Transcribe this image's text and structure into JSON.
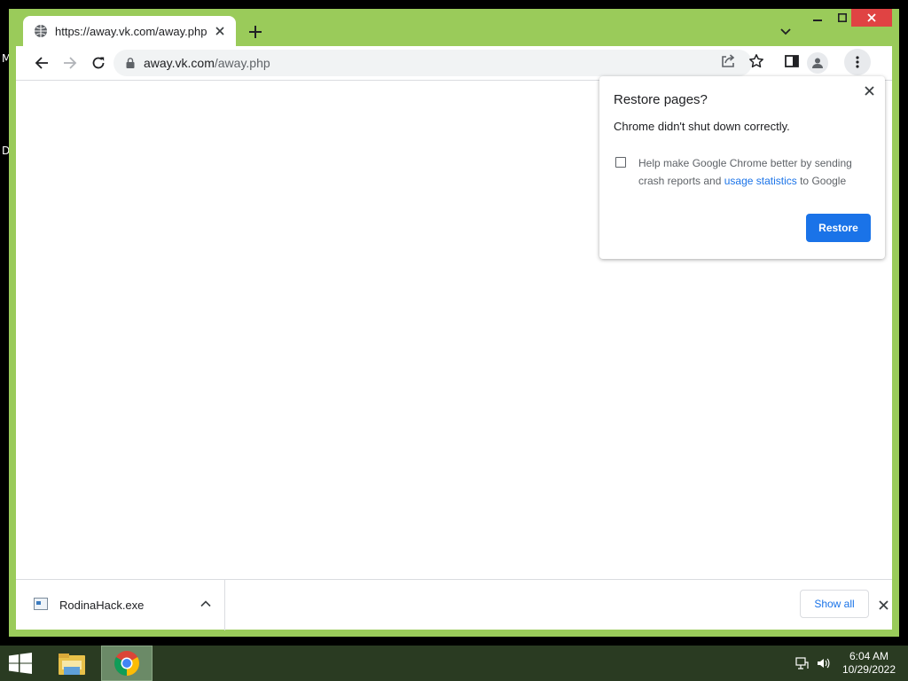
{
  "desktop": {
    "letters": [
      "M",
      "D"
    ]
  },
  "tab": {
    "title": "https://away.vk.com/away.php"
  },
  "omnibox": {
    "host": "away.vk.com",
    "path": "/away.php"
  },
  "popup": {
    "title": "Restore pages?",
    "message": "Chrome didn't shut down correctly.",
    "help_prefix": "Help make Google Chrome better by sending crash reports and ",
    "help_link": "usage statistics",
    "help_suffix": " to Google",
    "checkbox_checked": false,
    "restore_label": "Restore"
  },
  "download": {
    "filename": "RodinaHack.exe",
    "show_all_label": "Show all"
  },
  "taskbar": {
    "time": "6:04 AM",
    "date": "10/29/2022"
  },
  "colors": {
    "frame": "#9acb5a",
    "accent": "#1a73e8",
    "taskbar": "#2a3b22",
    "close": "#e04343"
  }
}
